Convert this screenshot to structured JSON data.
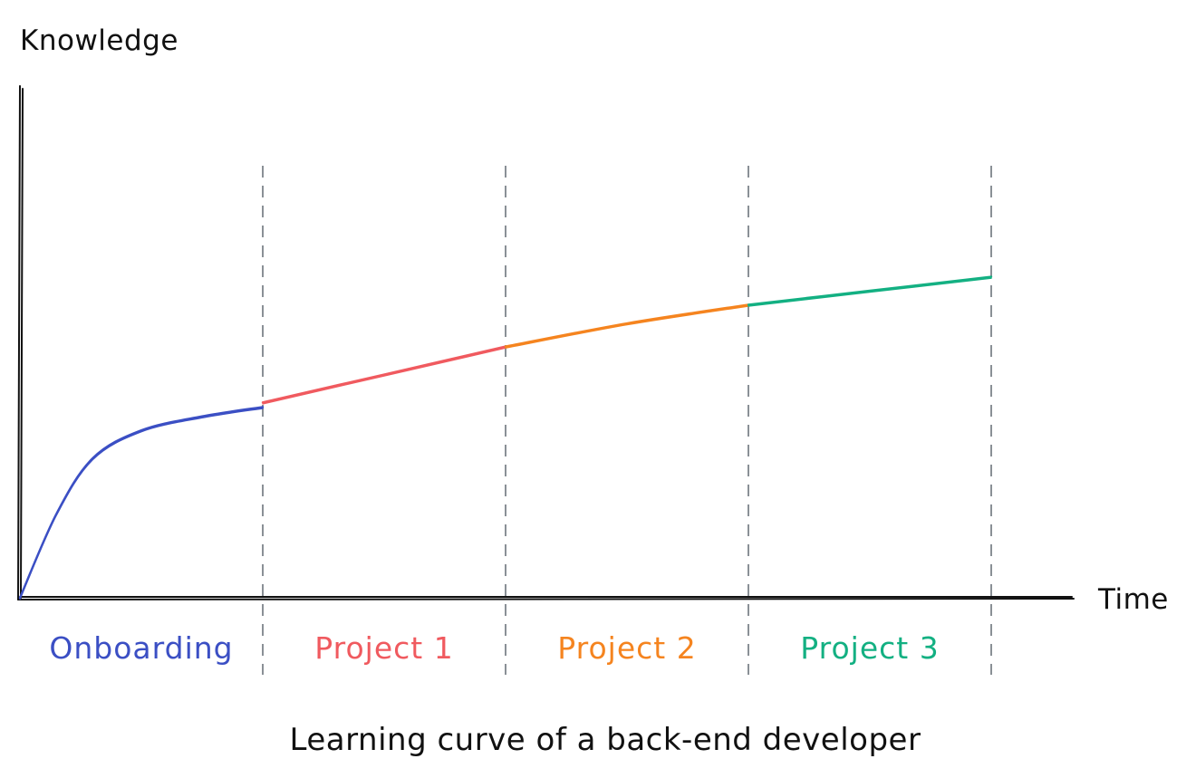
{
  "chart_data": {
    "type": "line",
    "title": "Learning curve of a back-end developer",
    "xlabel": "Time",
    "ylabel": "Knowledge",
    "grid": false,
    "legend": "none",
    "phases": [
      {
        "name": "Onboarding",
        "color": "#3b4fc4",
        "x_start": 0,
        "x_end": 1
      },
      {
        "name": "Project 1",
        "color": "#f05a5f",
        "x_start": 1,
        "x_end": 2
      },
      {
        "name": "Project 2",
        "color": "#f5841f",
        "x_start": 2,
        "x_end": 3
      },
      {
        "name": "Project 3",
        "color": "#13b082",
        "x_start": 3,
        "x_end": 4
      }
    ],
    "series": [
      {
        "color": "#3b4fc4",
        "points": [
          [
            0,
            0
          ],
          [
            0.15,
            0.18
          ],
          [
            0.3,
            0.3
          ],
          [
            0.5,
            0.36
          ],
          [
            0.75,
            0.39
          ],
          [
            1,
            0.41
          ]
        ]
      },
      {
        "color": "#f05a5f",
        "points": [
          [
            1,
            0.42
          ],
          [
            1.5,
            0.48
          ],
          [
            2,
            0.54
          ]
        ]
      },
      {
        "color": "#f5841f",
        "points": [
          [
            2,
            0.54
          ],
          [
            2.5,
            0.59
          ],
          [
            3,
            0.63
          ]
        ]
      },
      {
        "color": "#13b082",
        "points": [
          [
            3,
            0.63
          ],
          [
            3.5,
            0.66
          ],
          [
            4,
            0.69
          ]
        ]
      }
    ],
    "xlim": [
      0,
      4.35
    ],
    "ylim": [
      0,
      1.1
    ]
  }
}
